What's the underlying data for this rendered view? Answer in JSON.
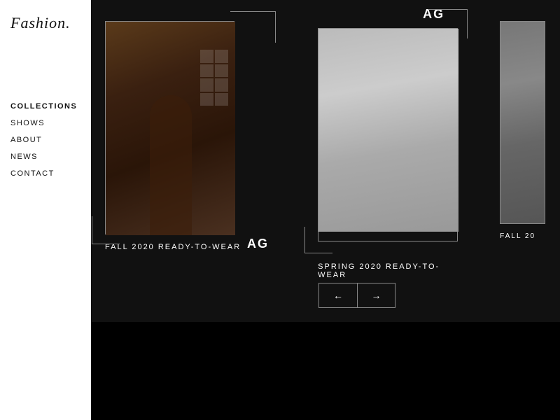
{
  "sidebar": {
    "logo": "Fashion.",
    "nav": [
      {
        "id": "collections",
        "label": "COLLECTIONS",
        "active": true
      },
      {
        "id": "shows",
        "label": "SHOWS",
        "active": false
      },
      {
        "id": "about",
        "label": "ABOUT",
        "active": false
      },
      {
        "id": "news",
        "label": "NEWS",
        "active": false
      },
      {
        "id": "contact",
        "label": "CONTACT",
        "active": false
      }
    ]
  },
  "main": {
    "cards": [
      {
        "id": "card-1",
        "ag_label": "AG",
        "title": "FALL 2020 READY-TO-WEAR"
      },
      {
        "id": "card-2",
        "ag_label": "AG",
        "title": "SPRING 2020 READY-TO-WEAR"
      },
      {
        "id": "card-3",
        "ag_label": "",
        "title": "FALL 20"
      }
    ],
    "arrows": {
      "prev": "←",
      "next": "→"
    }
  }
}
